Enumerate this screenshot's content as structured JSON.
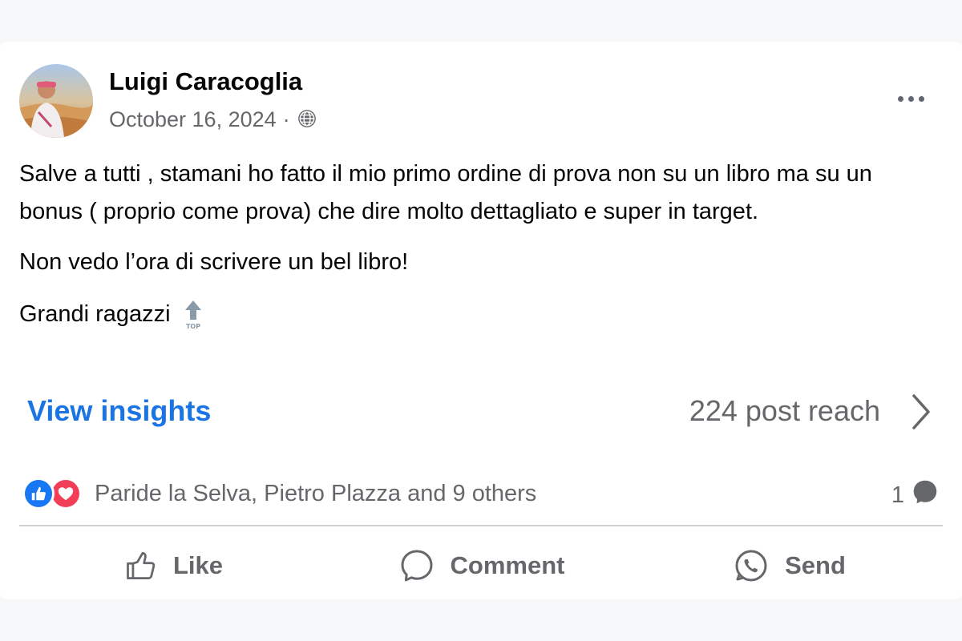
{
  "post": {
    "author_name": "Luigi Caracoglia",
    "date": "October 16, 2024",
    "separator": "·",
    "privacy_icon": "globe-icon",
    "more_icon": "more-options-icon",
    "paragraphs": [
      "Salve a tutti , stamani ho fatto il mio primo ordine di prova non su un libro ma su un bonus  ( proprio come prova) che dire molto dettagliato e super in target.",
      "Non vedo l’ora di scrivere un bel libro!",
      "Grandi ragazzi"
    ],
    "trailing_emoji": "top-arrow-emoji",
    "trailing_emoji_text": "TOP"
  },
  "insights": {
    "link_label": "View insights",
    "reach_text": "224 post reach"
  },
  "reactions": {
    "icons": [
      "like-reaction-icon",
      "love-reaction-icon"
    ],
    "summary": "Paride la Selva, Pietro Plazza and 9 others",
    "comment_count": "1"
  },
  "actions": [
    {
      "label": "Like",
      "icon": "thumbs-up-icon"
    },
    {
      "label": "Comment",
      "icon": "comment-bubble-icon"
    },
    {
      "label": "Send",
      "icon": "messenger-send-icon"
    }
  ],
  "colors": {
    "link_blue": "#1b74e4",
    "like_blue": "#1877f2",
    "love_red": "#f33e58",
    "secondary_text": "#65676b",
    "primary_text": "#050505"
  }
}
